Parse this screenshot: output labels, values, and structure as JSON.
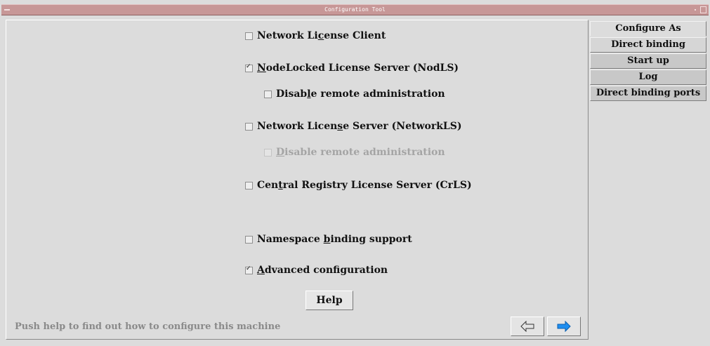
{
  "window": {
    "title": "Configuration Tool"
  },
  "options": [
    {
      "pre": "Network Li",
      "key": "c",
      "post": "ense Client",
      "checked": false,
      "disabled": false
    },
    {
      "pre": "",
      "key": "N",
      "post": "odeLocked License Server (NodLS)",
      "checked": true,
      "disabled": false
    },
    {
      "pre": "Disab",
      "key": "l",
      "post": "e remote administration",
      "checked": false,
      "disabled": false
    },
    {
      "pre": "Network Licen",
      "key": "s",
      "post": "e Server (NetworkLS)",
      "checked": false,
      "disabled": false
    },
    {
      "pre": "",
      "key": "D",
      "post": "isable remote administration",
      "checked": false,
      "disabled": true
    },
    {
      "pre": "Cen",
      "key": "t",
      "post": "ral Registry License Server (CrLS)",
      "checked": false,
      "disabled": false
    },
    {
      "pre": "Namespace ",
      "key": "b",
      "post": "inding support",
      "checked": false,
      "disabled": false
    },
    {
      "pre": "",
      "key": "A",
      "post": "dvanced configuration",
      "checked": true,
      "disabled": false
    }
  ],
  "help_button": "Help",
  "status_text": "Push help to find out how to configure this machine",
  "nav": {
    "prev_icon": "left-arrow-icon",
    "next_icon": "right-arrow-icon"
  },
  "tabs": [
    {
      "label": "Configure As",
      "active": true
    },
    {
      "label": "Direct binding",
      "active": false
    },
    {
      "label": "Start up",
      "active": false
    },
    {
      "label": "Log",
      "active": false
    },
    {
      "label": "Direct binding ports",
      "active": false
    }
  ],
  "colors": {
    "titlebar": "#c79797",
    "background": "#dcdcdc",
    "next_arrow": "#1e8ef0",
    "status_text": "#8a8a8a"
  }
}
